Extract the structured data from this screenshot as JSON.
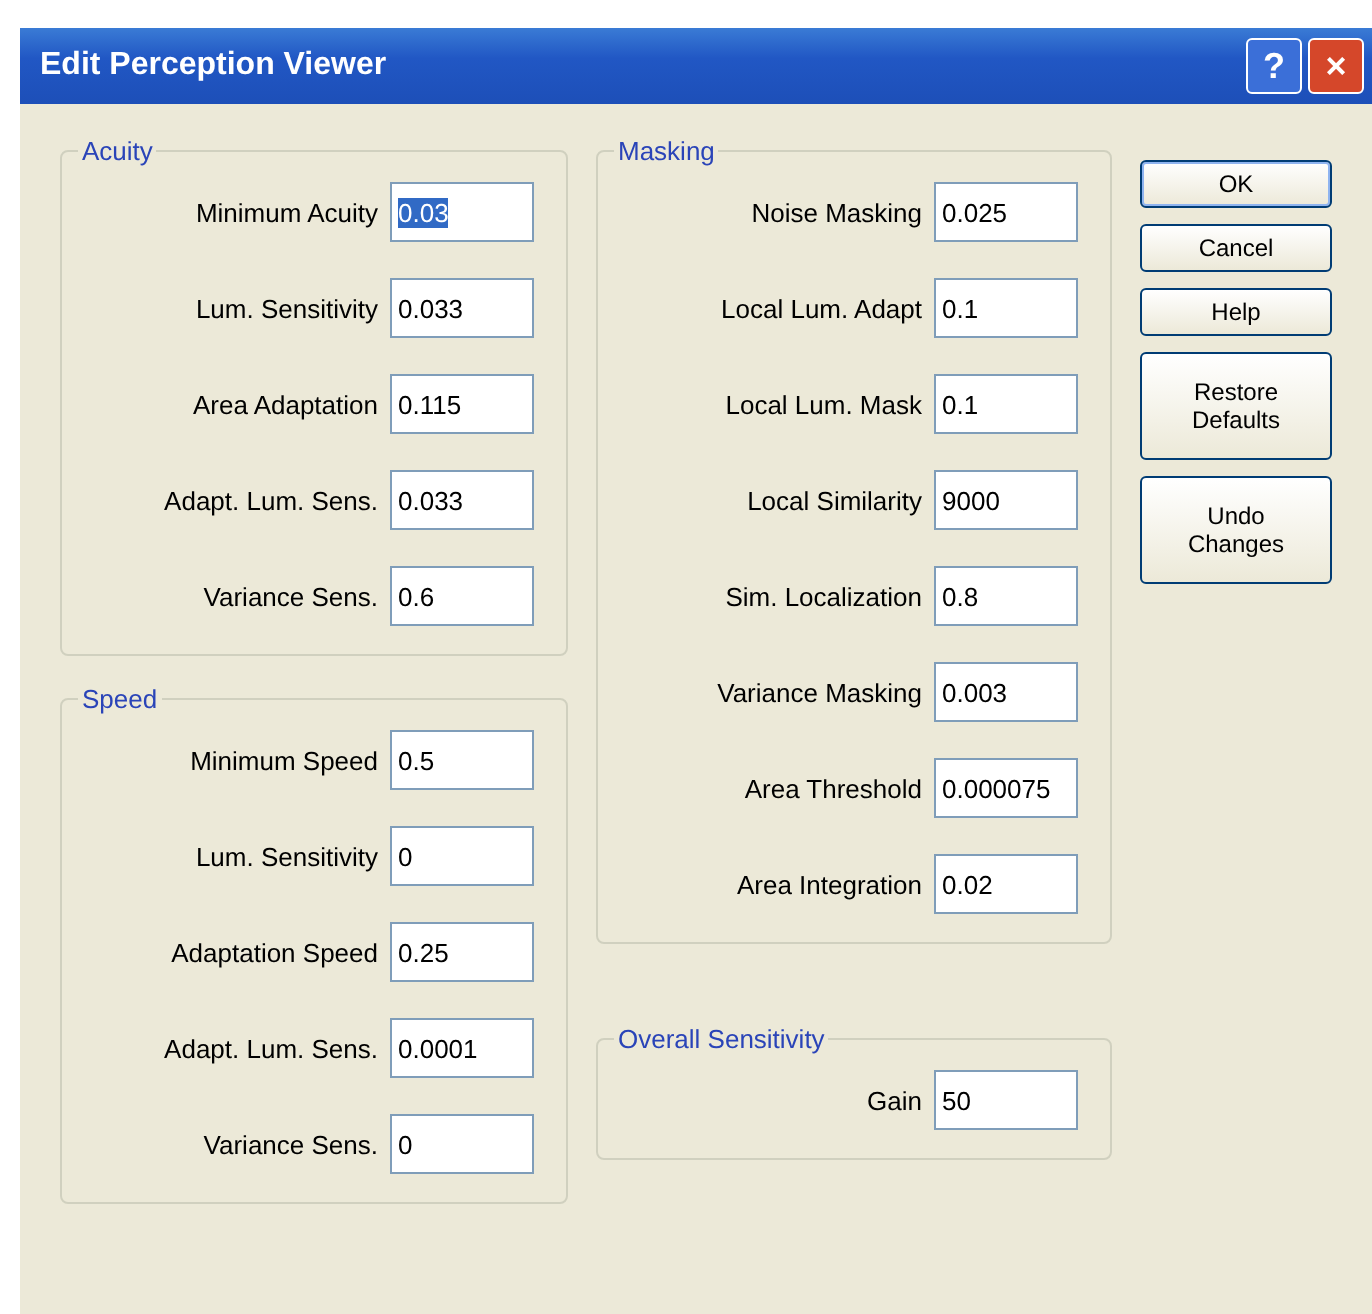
{
  "window": {
    "title": "Edit Perception Viewer",
    "title_buttons": [
      "?",
      "×"
    ]
  },
  "left_column": [
    {
      "title": "Acuity",
      "fields": [
        {
          "label": "Minimum Acuity",
          "value": "0.03",
          "selected": true
        },
        {
          "label": "Lum. Sensitivity",
          "value": "0.033",
          "selected": false
        },
        {
          "label": "Area Adaptation",
          "value": "0.115",
          "selected": false
        },
        {
          "label": "Adapt. Lum. Sens.",
          "value": "0.033",
          "selected": false
        },
        {
          "label": "Variance Sens.",
          "value": "0.6",
          "selected": false
        }
      ]
    },
    {
      "title": "Speed",
      "fields": [
        {
          "label": "Minimum Speed",
          "value": "0.5",
          "selected": false
        },
        {
          "label": "Lum. Sensitivity",
          "value": "0",
          "selected": false
        },
        {
          "label": "Adaptation Speed",
          "value": "0.25",
          "selected": false
        },
        {
          "label": "Adapt. Lum. Sens.",
          "value": "0.0001",
          "selected": false
        },
        {
          "label": "Variance Sens.",
          "value": "0",
          "selected": false
        }
      ]
    }
  ],
  "middle_column": [
    {
      "title": "Masking",
      "fields": [
        {
          "label": "Noise Masking",
          "value": "0.025",
          "selected": false
        },
        {
          "label": "Local Lum. Adapt",
          "value": "0.1",
          "selected": false
        },
        {
          "label": "Local Lum. Mask",
          "value": "0.1",
          "selected": false
        },
        {
          "label": "Local Similarity",
          "value": "9000",
          "selected": false
        },
        {
          "label": "Sim. Localization",
          "value": "0.8",
          "selected": false
        },
        {
          "label": "Variance Masking",
          "value": "0.003",
          "selected": false
        },
        {
          "label": "Area Threshold",
          "value": "0.000075",
          "selected": false
        },
        {
          "label": "Area Integration",
          "value": "0.02",
          "selected": false
        }
      ]
    },
    {
      "title": "Overall Sensitivity",
      "fields": [
        {
          "label": "Gain",
          "value": "50",
          "selected": false
        }
      ]
    }
  ],
  "buttons": [
    {
      "label": "OK",
      "kind": "default"
    },
    {
      "label": "Cancel",
      "kind": "normal"
    },
    {
      "label": "Help",
      "kind": "normal"
    },
    {
      "label": "Restore Defaults",
      "kind": "tall"
    },
    {
      "label": "Undo Changes",
      "kind": "tall"
    }
  ]
}
